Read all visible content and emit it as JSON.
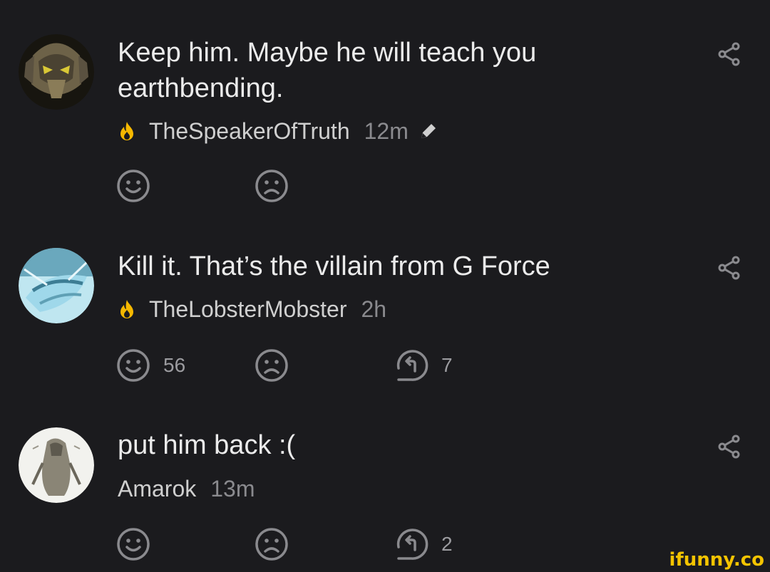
{
  "comments": [
    {
      "text": "Keep him. Maybe he will teach you earthbending.",
      "username": "TheSpeakerOfTruth",
      "time": "12m",
      "has_fire": true,
      "edited": true,
      "smile_count": "",
      "reply_count": ""
    },
    {
      "text": "Kill it. That’s the villain from G Force",
      "username": "TheLobsterMobster",
      "time": "2h",
      "has_fire": true,
      "edited": false,
      "smile_count": "56",
      "reply_count": "7"
    },
    {
      "text": "put him back :(",
      "username": "Amarok",
      "time": "13m",
      "has_fire": false,
      "edited": false,
      "smile_count": "",
      "reply_count": "2"
    }
  ],
  "watermark": "ifunny.co",
  "colors": {
    "background": "#1b1b1e",
    "icon": "#8a8a8e",
    "fire": "#f5b800",
    "watermark": "#f5c400"
  },
  "icons": [
    "fire-icon",
    "pencil-icon",
    "share-icon",
    "smile-icon",
    "unsmile-icon",
    "reply-icon"
  ]
}
